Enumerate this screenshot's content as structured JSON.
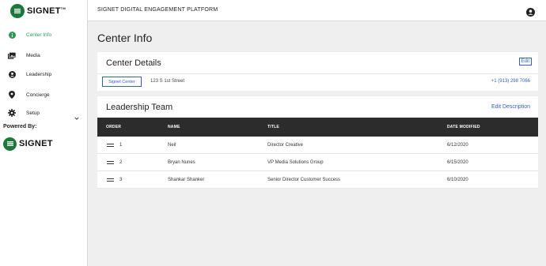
{
  "brand": {
    "name": "SIGNET",
    "tm": "TM",
    "accent": "#2e9a4e",
    "link_color": "#2f5fd0"
  },
  "sidebar": {
    "items": [
      {
        "label": "Center Info",
        "icon": "info-icon",
        "active": true
      },
      {
        "label": "Media",
        "icon": "media-icon",
        "active": false
      },
      {
        "label": "Leadership",
        "icon": "person-icon",
        "active": false
      },
      {
        "label": "Concierge",
        "icon": "location-pin-icon",
        "active": false
      },
      {
        "label": "Setup",
        "icon": "gear-icon",
        "active": false,
        "expandable": true
      }
    ],
    "powered_by": "Powered By:"
  },
  "topbar": {
    "title": "SIGNET DIGITAL ENGAGEMENT PLATFORM"
  },
  "page": {
    "title": "Center Info"
  },
  "center_details": {
    "title": "Center Details",
    "edit_label": "Edit",
    "center_button": "Signet Center",
    "address": "123 S 1st Street",
    "phone": "+1 (913) 298 7066"
  },
  "leadership": {
    "title": "Leadership Team",
    "edit_desc": "Edit Description",
    "columns": [
      "ORDER",
      "NAME",
      "TITLE",
      "DATE MODIFIED"
    ],
    "rows": [
      {
        "order": "1",
        "name": "Neil",
        "title": "Director Creative",
        "date": "6/12/2020"
      },
      {
        "order": "2",
        "name": "Bryan Nunes",
        "title": "VP Media Solutions Group",
        "date": "6/15/2020"
      },
      {
        "order": "3",
        "name": "Shankar Shanker",
        "title": "Senior Director Customer Success",
        "date": "6/10/2020"
      }
    ]
  }
}
